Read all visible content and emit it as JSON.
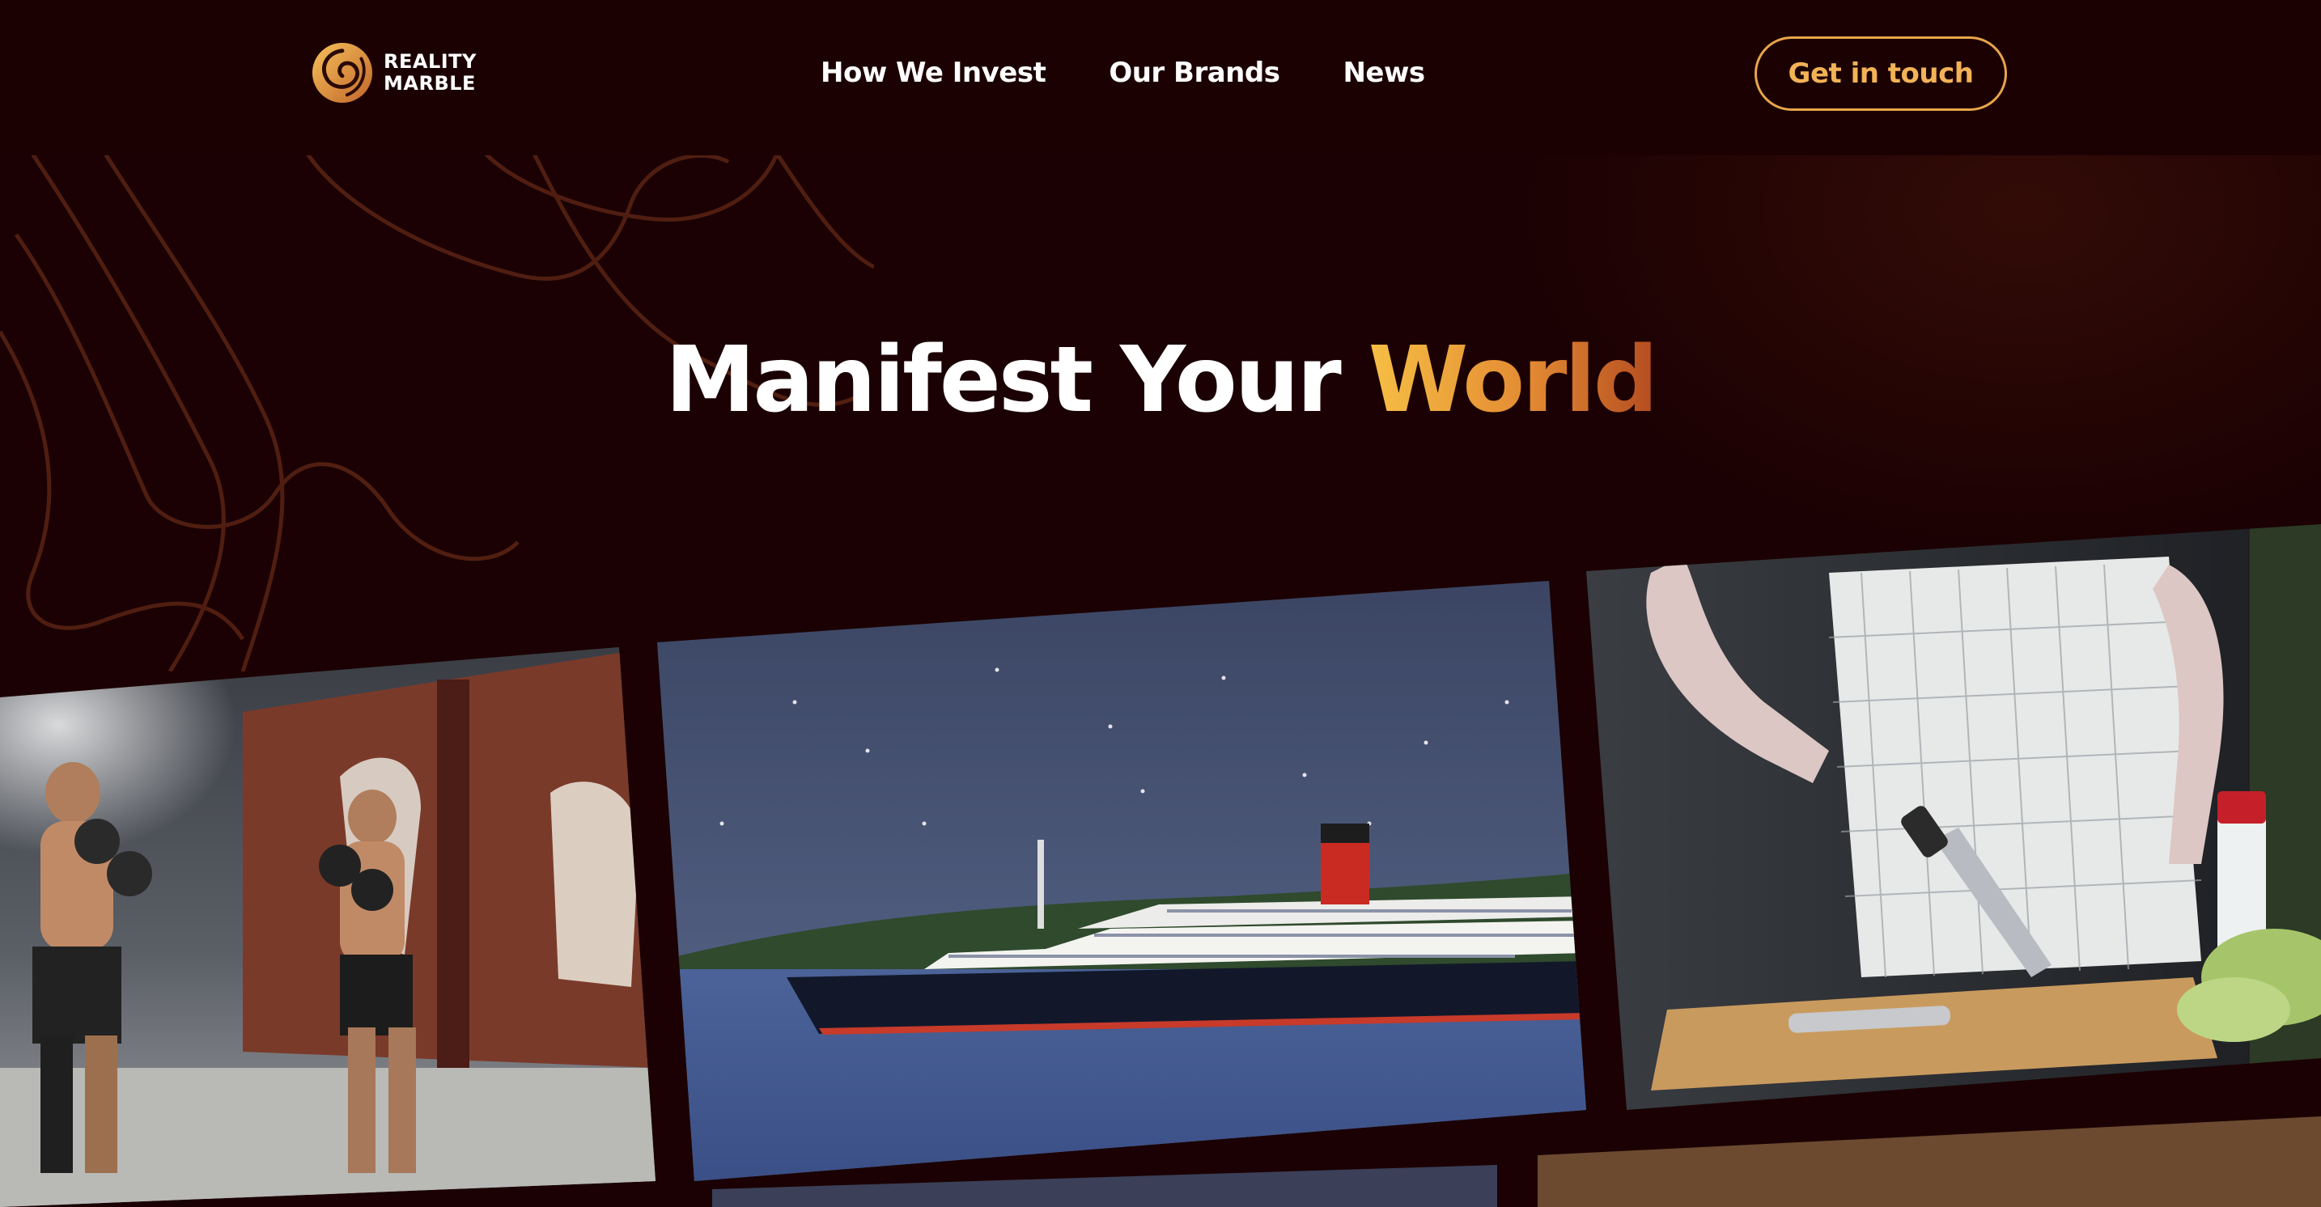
{
  "header": {
    "logo": {
      "line1": "REALITY",
      "line2": "MARBLE",
      "icon": "swirl-logo-icon"
    },
    "nav": [
      {
        "label": "How We Invest"
      },
      {
        "label": "Our Brands"
      },
      {
        "label": "News"
      }
    ],
    "cta_label": "Get in touch"
  },
  "hero": {
    "title_part1": "Manifest Your ",
    "title_part2": "World"
  },
  "tiles": [
    {
      "icon": "boxing-training-photo"
    },
    {
      "icon": "cruise-ship-illustration"
    },
    {
      "icon": "cooking-chopping-photo"
    }
  ],
  "colors": {
    "background": "#1b0103",
    "accent": "#f2b257",
    "accent_dark": "#b44c20",
    "text": "#ffffff"
  }
}
